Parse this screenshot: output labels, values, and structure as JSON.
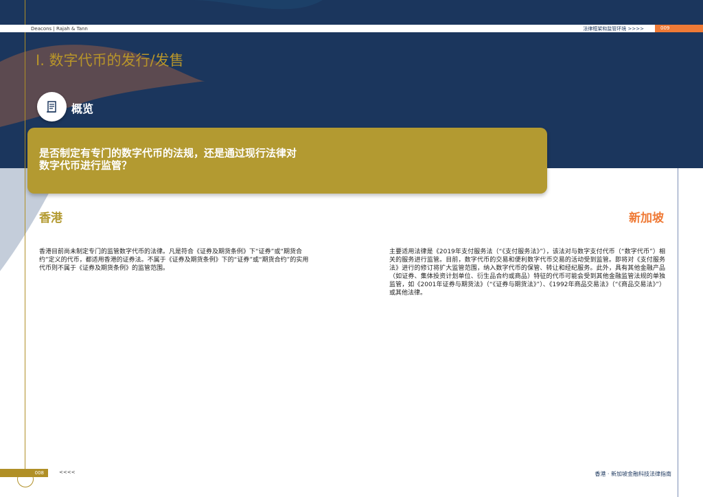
{
  "header": {
    "brand": "Deacons | Rajah & Tann",
    "section": "法律框架和监管环境 >>>>",
    "page": "009"
  },
  "title": "I. 数字代币的发行/发售",
  "overview": {
    "label": "概览",
    "icon": "scroll-icon"
  },
  "question": {
    "line1": "是否制定有专门的数字代币的法规，还是通过现行法律对",
    "line2": "数字代币进行监管？"
  },
  "hongkong": {
    "heading": "香港",
    "text": "香港目前尚未制定专门的监管数字代币的法律。凡是符合《证券及期货条例》下“证券”或“期货合约”定义的代币，都适用香港的证券法。不属于《证券及期货条例》下的“证券”或“期货合约”的实用代币则不属于《证券及期货条例》的监管范围。"
  },
  "singapore": {
    "heading": "新加坡",
    "text": "主要适用法律是《2019年支付服务法（“《支付服务法》”），该法对与数字支付代币（“数字代币”）相关的服务进行监管。目前，数字代币的交易和便利数字代币交易的活动受到监管。即将对《支付服务法》进行的修订将扩大监管范围，纳入数字代币的保管、转让和经纪服务。此外，具有其他金融产品（如证券、集体投资计划单位、衍生品合约或商品）特征的代币可能会受到其他金融监管法规的单独监管，如《2001年证券与期货法》（“《证券与期货法》”）、《1992年商品交易法》（“《商品交易法》”）或其他法律。"
  },
  "footer": {
    "page": "008",
    "nav": "<<<<",
    "title": "香港 · 新加坡金融科技法律指南"
  },
  "colors": {
    "navy": "#1b365d",
    "gold": "#b39a31",
    "orange": "#ef7a36"
  }
}
